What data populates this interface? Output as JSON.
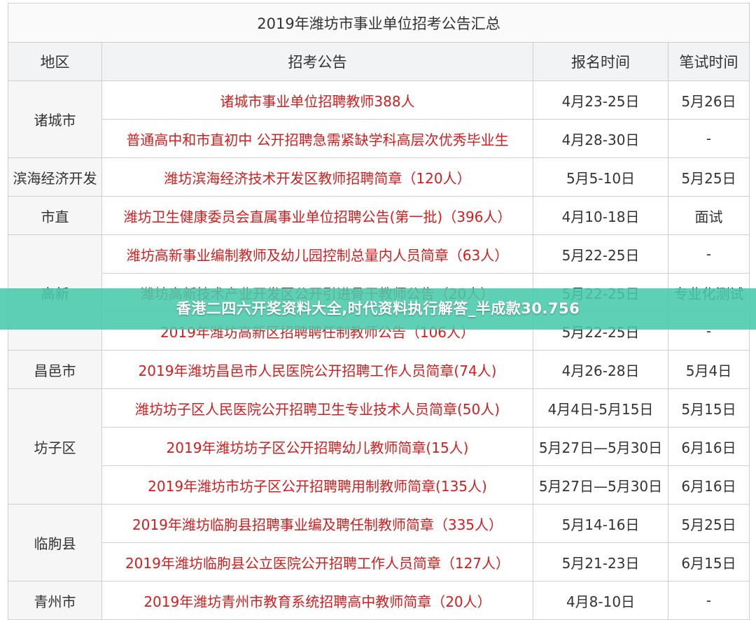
{
  "table": {
    "title": "2019年潍坊市事业单位招考公告汇总",
    "headers": {
      "region": "地区",
      "notice": "招考公告",
      "signup": "报名时间",
      "exam": "笔试时间"
    },
    "regions": [
      {
        "name": "诸城市"
      },
      {
        "name": "滨海经济开发"
      },
      {
        "name": "市直"
      },
      {
        "name": "高新"
      },
      {
        "name": "昌邑市"
      },
      {
        "name": "坊子区"
      },
      {
        "name": "临朐县"
      },
      {
        "name": "青州市"
      }
    ],
    "rows": [
      {
        "notice": "诸城市事业单位招聘教师388人",
        "signup": "4月23-25日",
        "exam": "5月26日"
      },
      {
        "notice": "普通高中和市直初中 公开招聘急需紧缺学科高层次优秀毕业生",
        "signup": "4月28-30日",
        "exam": "-"
      },
      {
        "notice": "潍坊滨海经济技术开发区教师招聘简章（120人）",
        "signup": "5月5-10日",
        "exam": "5月25日"
      },
      {
        "notice": "潍坊卫生健康委员会直属事业单位招聘公告(第一批)（396人）",
        "signup": "4月10-18日",
        "exam": "面试"
      },
      {
        "notice": "潍坊高新事业编制教师及幼儿园控制总量内人员简章（63人）",
        "signup": "5月22-25日",
        "exam": "-"
      },
      {
        "notice": "潍坊高新技术产业开发区公开引进骨干教师公告（20人）",
        "signup": "5月22-25日",
        "exam": "专业化测试"
      },
      {
        "notice": "2019年潍坊高新区招聘聘任制教师公告（106人）",
        "signup": "5月22-25日",
        "exam": "-"
      },
      {
        "notice": "2019年潍坊昌邑市人民医院公开招聘工作人员简章(74人)",
        "signup": "4月26-28日",
        "exam": "5月4日"
      },
      {
        "notice": "潍坊坊子区人民医院公开招聘卫生专业技术人员简章(50人)",
        "signup": "4月4日-5月15日",
        "exam": "5月15日"
      },
      {
        "notice": "2019年潍坊坊子区公开招聘幼儿教师简章(15人)",
        "signup": "5月27日—5月30日",
        "exam": "6月16日"
      },
      {
        "notice": "2019年潍坊市坊子区公开招聘聘用制教师简章(135人)",
        "signup": "5月27日—5月30日",
        "exam": "6月16日"
      },
      {
        "notice": "2019年潍坊临朐县招聘事业编及聘任制教师简章（335人）",
        "signup": "5月14-16日",
        "exam": "5月25日"
      },
      {
        "notice": "2019年潍坊临朐县公立医院公开招聘工作人员简章（127人）",
        "signup": "5月21-23日",
        "exam": "6月15日"
      },
      {
        "notice": "2019年潍坊青州市教育系统招聘高中教师简章（20人）",
        "signup": "4月8-10日",
        "exam": "-"
      }
    ]
  },
  "banner": {
    "text": "香港二四六开奖资料大全,时代资料执行解答_半成款30.756",
    "color": "#48c9ab"
  },
  "colors": {
    "notice_text": "#d21e1e",
    "border": "#cfcfcf"
  }
}
